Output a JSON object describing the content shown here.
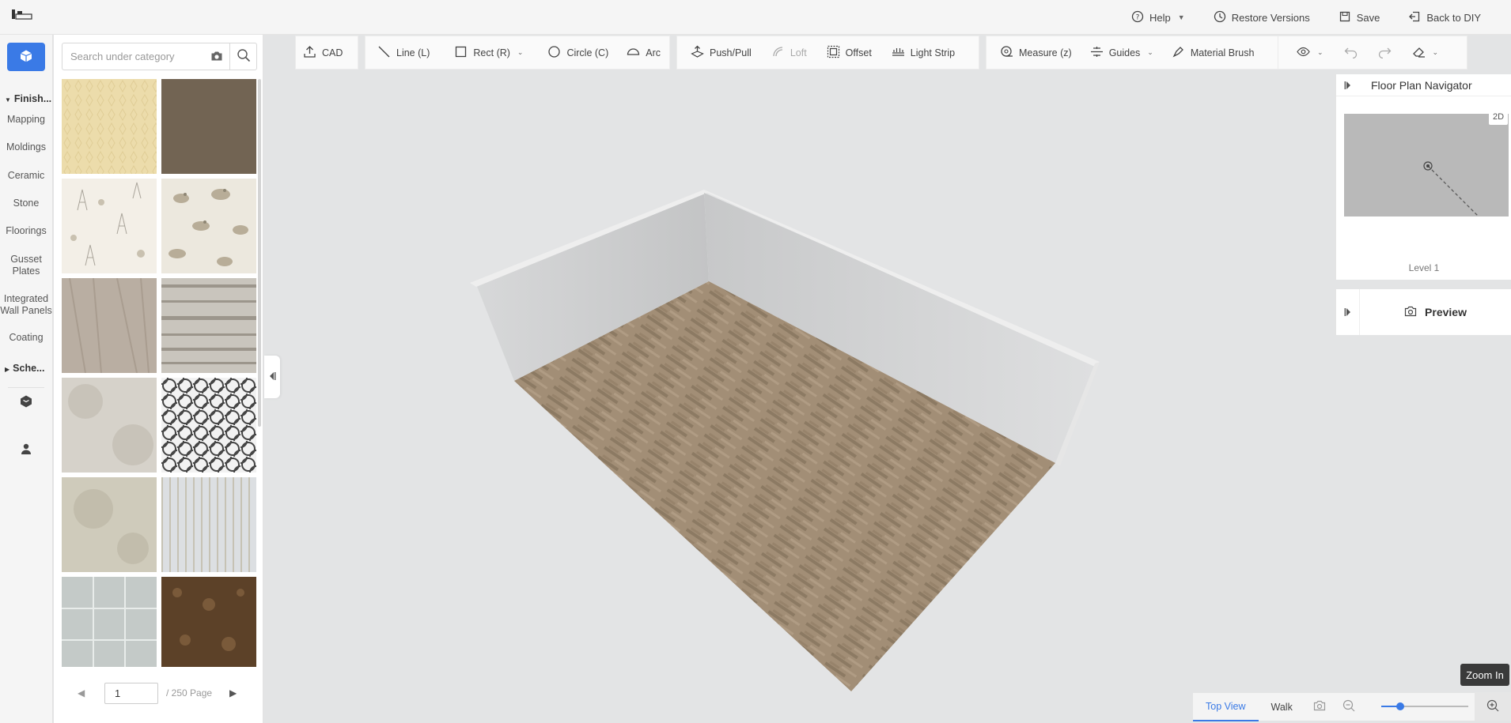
{
  "topbar": {
    "help": "Help",
    "restore": "Restore Versions",
    "save": "Save",
    "back": "Back to DIY"
  },
  "leftnav": {
    "categories": [
      {
        "label": "Finish..."
      },
      {
        "label": "Mapping"
      },
      {
        "label": "Moldings"
      },
      {
        "label": "Ceramic"
      },
      {
        "label": "Stone"
      },
      {
        "label": "Floorings"
      },
      {
        "label": "Gusset Plates"
      },
      {
        "label": "Integrated Wall Panels"
      },
      {
        "label": "Coating"
      },
      {
        "label": "Sche..."
      }
    ]
  },
  "panel": {
    "search_placeholder": "Search under category",
    "page_current": "1",
    "page_total": "/ 250 Page"
  },
  "toolbar": {
    "cad": "CAD",
    "line": "Line (L)",
    "rect": "Rect (R)",
    "circle": "Circle (C)",
    "arc": "Arc",
    "pushpull": "Push/Pull",
    "loft": "Loft",
    "offset": "Offset",
    "lightstrip": "Light Strip",
    "measure": "Measure (z)",
    "guides": "Guides",
    "brush": "Material Brush"
  },
  "navigator": {
    "title": "Floor Plan Navigator",
    "badge": "2D",
    "level": "Level 1"
  },
  "preview": {
    "label": "Preview"
  },
  "bottombar": {
    "top_view": "Top View",
    "walk": "Walk",
    "zoom_tooltip": "Zoom In",
    "zoom_level": 0.22
  },
  "colors": {
    "accent": "#3a7ae6",
    "floor": "#9c8a74",
    "wall": "#cfd0d1"
  }
}
